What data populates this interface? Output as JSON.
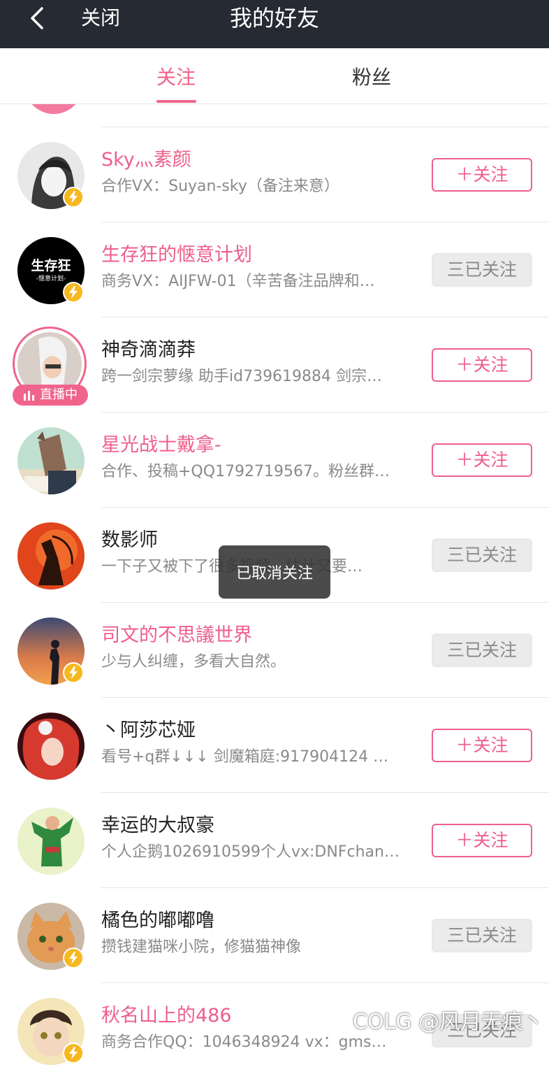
{
  "header": {
    "back_icon": "chevron-left-icon",
    "close_label": "关闭",
    "title": "我的好友"
  },
  "tabs": [
    {
      "label": "关注",
      "active": true
    },
    {
      "label": "粉丝",
      "active": false
    }
  ],
  "colors": {
    "accent": "#ee5f8b",
    "header_bg": "#262a33",
    "badge": "#f7b81f"
  },
  "users": [
    {
      "name": "Sky灬素颜",
      "desc": "合作VX：Suyan-sky（备注来意）",
      "followed": false,
      "verified": true,
      "name_pink": true
    },
    {
      "name": "生存狂的惬意计划",
      "desc": "商务VX：AIJFW-01（辛苦备注品牌和…",
      "followed": true,
      "verified": true,
      "name_pink": true,
      "avatar_text": "生存狂",
      "avatar_sub": "-惬意计划-"
    },
    {
      "name": "神奇滴滴莽",
      "desc": "跨一剑宗萝缘 助手id739619884 剑宗…",
      "followed": false,
      "verified": false,
      "name_pink": false,
      "live": true,
      "live_label": "直播中"
    },
    {
      "name": "星光战士戴拿-",
      "desc": "合作、投稿+QQ1792719567。粉丝群…",
      "followed": false,
      "verified": false,
      "name_pink": true
    },
    {
      "name": "数影师",
      "desc": "一下子又被下了很多视频，估计又要…",
      "followed": true,
      "verified": false,
      "name_pink": false
    },
    {
      "name": "司文的不思議世界",
      "desc": "少与人纠缠，多看大自然。",
      "followed": true,
      "verified": true,
      "name_pink": true
    },
    {
      "name": "丶阿莎芯娅",
      "desc": "看号+q群↓↓↓ 剑魔箱庭:917904124 小…",
      "followed": false,
      "verified": false,
      "name_pink": false
    },
    {
      "name": "幸运的大叔豪",
      "desc": "个人企鹅1026910599个人vx:DNFchan…",
      "followed": false,
      "verified": false,
      "name_pink": false
    },
    {
      "name": "橘色的嘟嘟噜",
      "desc": "攒钱建猫咪小院，修猫猫神像",
      "followed": true,
      "verified": true,
      "name_pink": false
    },
    {
      "name": "秋名山上的486",
      "desc": "商务合作QQ：1046348924 vx：gms…",
      "followed": true,
      "verified": true,
      "name_pink": true
    }
  ],
  "buttons": {
    "follow": "＋关注",
    "followed": "三已关注"
  },
  "toast": "已取消关注",
  "watermark": "COLG @风月无痕丶"
}
